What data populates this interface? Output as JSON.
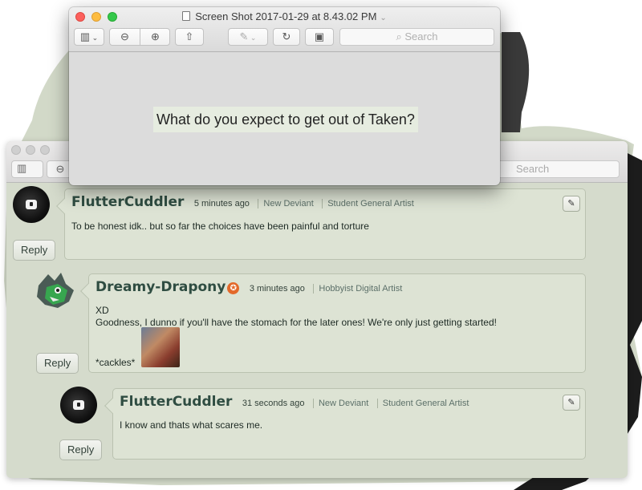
{
  "front_window": {
    "title": "Screen Shot 2017-01-29 at 8.43.02 PM",
    "title_chevron": "⌄",
    "search_placeholder": "Search",
    "content_text": "What do you expect to get out of Taken?"
  },
  "back_window": {
    "search_placeholder": "Search"
  },
  "comments": [
    {
      "username": "FlutterCuddler",
      "time": "5 minutes ago",
      "tags": [
        "New Deviant",
        "Student General Artist"
      ],
      "body": [
        "To be honest idk.. but so far the choices have been painful and torture"
      ],
      "reply_label": "Reply"
    },
    {
      "username": "Dreamy-Drapony",
      "time": "3 minutes ago",
      "tags": [
        "Hobbyist Digital Artist"
      ],
      "body": [
        "XD",
        "Goodness, I dunno if you'll have the stomach for the later ones! We're only just getting started!",
        "*cackles*"
      ],
      "reply_label": "Reply"
    },
    {
      "username": "FlutterCuddler",
      "time": "31 seconds ago",
      "tags": [
        "New Deviant",
        "Student General Artist"
      ],
      "body": [
        "I know and thats what scares me."
      ],
      "reply_label": "Reply"
    }
  ],
  "icons": {
    "sidebar": "▥",
    "zoom_out": "⊖",
    "zoom_in": "⊕",
    "share": "⇧",
    "edit": "✎",
    "rotate": "↻",
    "toolbox": "▣",
    "search": "⌕",
    "star": "✪"
  },
  "colors": {
    "username": "#2f4d42",
    "comment_bg": "#dde3d4",
    "badge": "#e3692a",
    "traffic_red": "#fc605c",
    "traffic_yellow": "#fdbc40",
    "traffic_green": "#34c84a"
  }
}
